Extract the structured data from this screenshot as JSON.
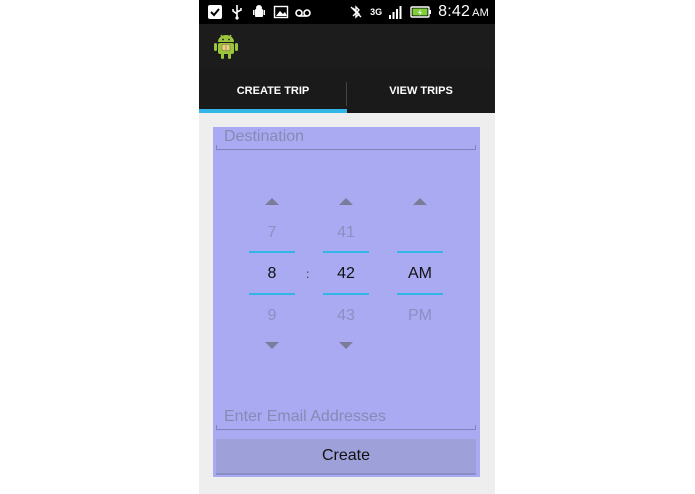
{
  "status_bar": {
    "network": "3G",
    "time": "8:42",
    "ampm": "AM",
    "icons": [
      "check-icon",
      "usb-icon",
      "android-debug-icon",
      "image-icon",
      "voicemail-icon",
      "bluetooth-off-icon",
      "signal-icon",
      "battery-icon"
    ]
  },
  "tabs": [
    {
      "label": "CREATE TRIP",
      "active": true
    },
    {
      "label": "VIEW TRIPS",
      "active": false
    }
  ],
  "form": {
    "destination_placeholder": "Destination",
    "email_placeholder": "Enter Email Addresses",
    "create_label": "Create"
  },
  "time_picker": {
    "hour": {
      "prev": "7",
      "current": "8",
      "next": "9"
    },
    "separator": ":",
    "minute": {
      "prev": "41",
      "current": "42",
      "next": "43"
    },
    "ampm": {
      "current": "AM",
      "next": "PM"
    }
  },
  "colors": {
    "accent": "#33b5e5",
    "overlay": "#a9aaf2",
    "actionbar": "#1c1c1c"
  }
}
